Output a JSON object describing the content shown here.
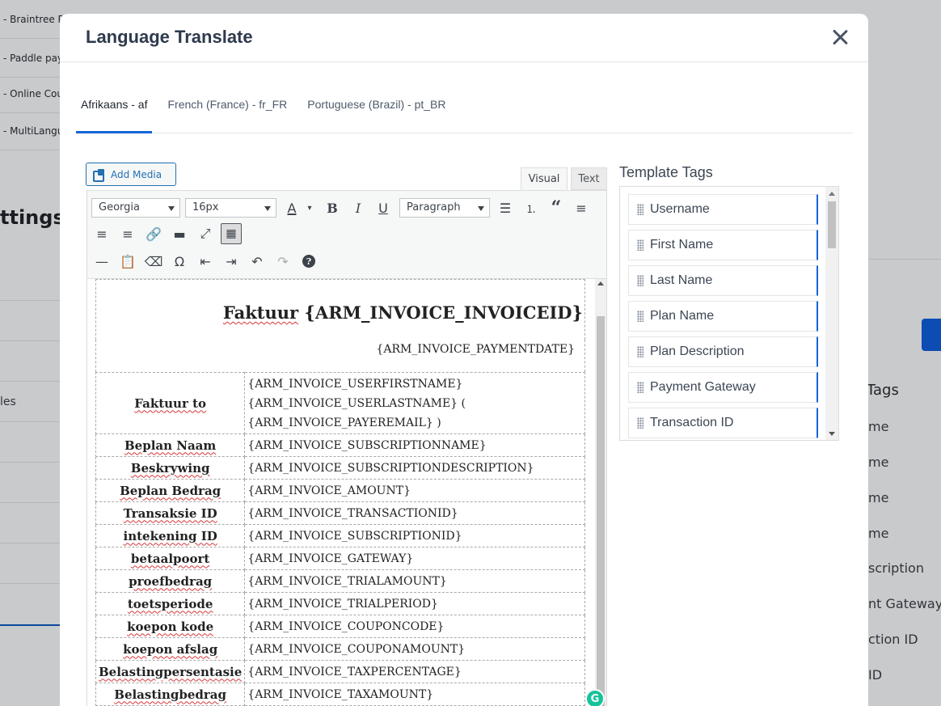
{
  "background": {
    "rows": [
      "- Braintree Pa",
      "- Paddle payn",
      "- Online Cou",
      "- MultiLangu"
    ],
    "settings_title": "ttings",
    "left_items": [
      "",
      "",
      "les",
      "",
      "",
      "",
      ""
    ],
    "tags_title": "Tags",
    "tags": [
      "me",
      "me",
      "me",
      "me",
      "scription",
      "nt Gateway",
      "ction ID",
      "ID"
    ]
  },
  "modal": {
    "title": "Language Translate",
    "tabs": [
      {
        "label": "Afrikaans - af",
        "active": true
      },
      {
        "label": "French (France) - fr_FR",
        "active": false
      },
      {
        "label": "Portuguese (Brazil) - pt_BR",
        "active": false
      }
    ],
    "editor": {
      "add_media_label": "Add Media",
      "mode_visual": "Visual",
      "mode_text": "Text",
      "font_family": "Georgia",
      "font_size": "16px",
      "block_format": "Paragraph",
      "text_color_icon": "A",
      "bold_icon": "B",
      "italic_icon": "I",
      "underline_icon": "U",
      "omega_icon": "Ω",
      "help_icon": "?",
      "grammarly_icon": "G"
    },
    "document": {
      "title_label": "Faktuur",
      "title_tag": "{ARM_INVOICE_INVOICEID}",
      "date_tag": "{ARM_INVOICE_PAYMENTDATE}",
      "bill_to_label": "Faktuur to",
      "bill_to_lines": [
        "{ARM_INVOICE_USERFIRSTNAME}",
        "{ARM_INVOICE_USERLASTNAME} (",
        "{ARM_INVOICE_PAYEREMAIL} )"
      ],
      "rows": [
        {
          "label": "Beplan Naam",
          "value": "{ARM_INVOICE_SUBSCRIPTIONNAME}"
        },
        {
          "label": "Beskrywing",
          "value": "{ARM_INVOICE_SUBSCRIPTIONDESCRIPTION}"
        },
        {
          "label": "Beplan Bedrag",
          "value": "{ARM_INVOICE_AMOUNT}"
        },
        {
          "label": "Transaksie ID",
          "value": "{ARM_INVOICE_TRANSACTIONID}"
        },
        {
          "label": "intekening ID",
          "value": "{ARM_INVOICE_SUBSCRIPTIONID}"
        },
        {
          "label": "betaalpoort",
          "value": "{ARM_INVOICE_GATEWAY}"
        },
        {
          "label": "proefbedrag",
          "value": "{ARM_INVOICE_TRIALAMOUNT}"
        },
        {
          "label": "toetsperiode",
          "value": "{ARM_INVOICE_TRIALPERIOD}"
        },
        {
          "label": "koepon kode",
          "value": "{ARM_INVOICE_COUPONCODE}"
        },
        {
          "label": "koepon afslag",
          "value": "{ARM_INVOICE_COUPONAMOUNT}"
        },
        {
          "label": "Belastingpersentasie",
          "value": "{ARM_INVOICE_TAXPERCENTAGE}"
        },
        {
          "label": "Belastingbedrag",
          "value": "{ARM_INVOICE_TAXAMOUNT}"
        }
      ]
    },
    "template_tags": {
      "title": "Template Tags",
      "items": [
        "Username",
        "First Name",
        "Last Name",
        "Plan Name",
        "Plan Description",
        "Payment Gateway",
        "Transaction ID"
      ]
    }
  },
  "colors": {
    "accent": "#1565d8",
    "wp_blue": "#2271b1",
    "grammarly": "#15c39a"
  }
}
